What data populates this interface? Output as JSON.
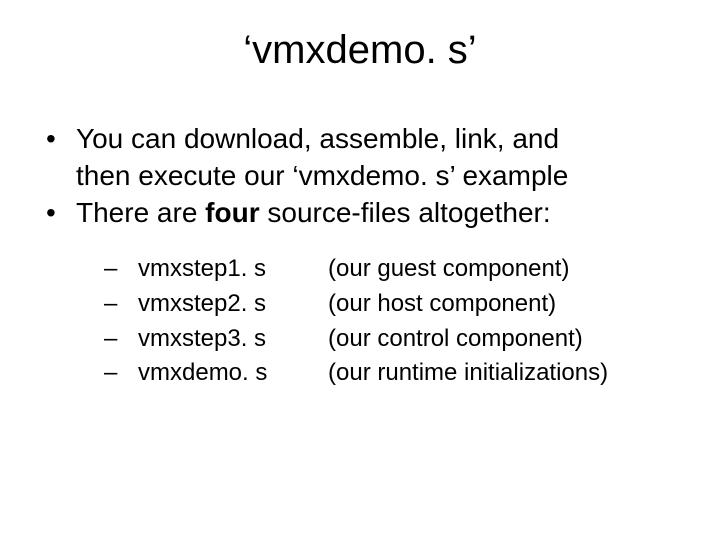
{
  "title": "‘vmxdemo. s’",
  "bullets": {
    "l1a": "You can download, assemble, link, and",
    "l1b": "then execute our ‘vmxdemo. s’ example",
    "l2a": "There are ",
    "l2bold": "four",
    "l2b": " source-files altogether:"
  },
  "items": [
    {
      "file": "vmxstep1. s",
      "desc": "(our guest component)"
    },
    {
      "file": "vmxstep2. s",
      "desc": "(our host component)"
    },
    {
      "file": "vmxstep3. s",
      "desc": "(our control component)"
    },
    {
      "file": "vmxdemo. s",
      "desc": "(our runtime initializations)"
    }
  ]
}
